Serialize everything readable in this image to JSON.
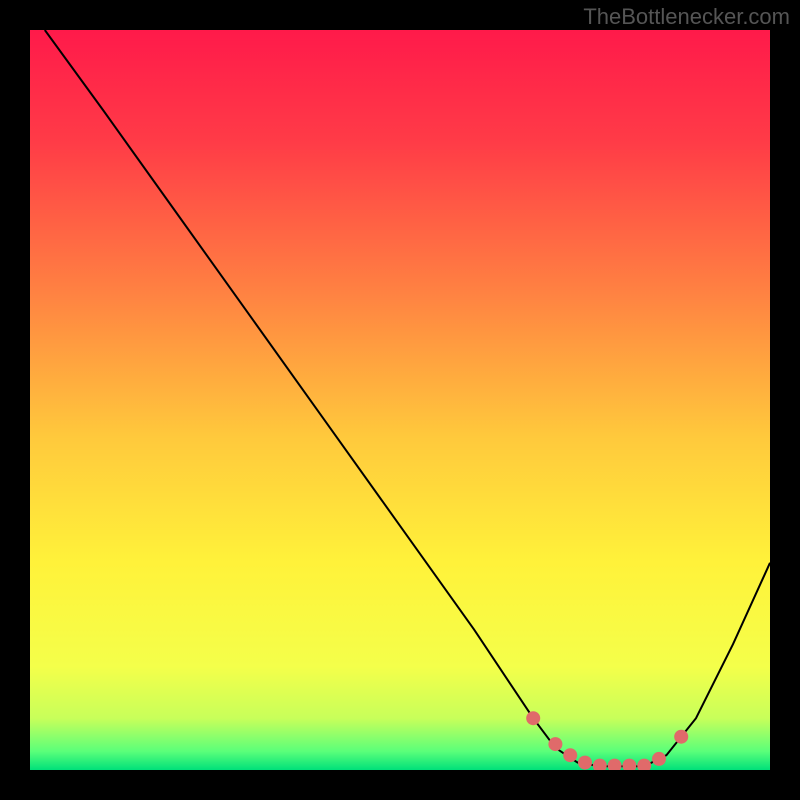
{
  "watermark": "TheBottlenecker.com",
  "chart_data": {
    "type": "line",
    "title": "",
    "xlabel": "",
    "ylabel": "",
    "xlim": [
      0,
      100
    ],
    "ylim": [
      0,
      100
    ],
    "background_gradient": {
      "stops": [
        {
          "offset": 0.0,
          "color": "#ff1a4a"
        },
        {
          "offset": 0.15,
          "color": "#ff3b47"
        },
        {
          "offset": 0.35,
          "color": "#ff8042"
        },
        {
          "offset": 0.55,
          "color": "#ffc93c"
        },
        {
          "offset": 0.72,
          "color": "#fff23a"
        },
        {
          "offset": 0.86,
          "color": "#f4ff4a"
        },
        {
          "offset": 0.93,
          "color": "#c8ff5a"
        },
        {
          "offset": 0.975,
          "color": "#5aff7a"
        },
        {
          "offset": 1.0,
          "color": "#00e07a"
        }
      ]
    },
    "series": [
      {
        "name": "bottleneck-curve",
        "x": [
          2,
          10,
          20,
          30,
          40,
          50,
          60,
          68,
          71,
          74,
          77,
          80,
          83,
          86,
          90,
          95,
          100
        ],
        "y": [
          100,
          89,
          75,
          61,
          47,
          33,
          19,
          7,
          3,
          1,
          0.5,
          0.5,
          0.5,
          2,
          7,
          17,
          28
        ],
        "stroke": "#000000",
        "stroke_width": 2
      }
    ],
    "markers": {
      "name": "highlight-dots",
      "x": [
        68,
        71,
        73,
        75,
        77,
        79,
        81,
        83,
        85,
        88
      ],
      "y": [
        7,
        3.5,
        2,
        1,
        0.6,
        0.6,
        0.6,
        0.6,
        1.5,
        4.5
      ],
      "color": "#e06a6a",
      "radius": 7
    }
  }
}
